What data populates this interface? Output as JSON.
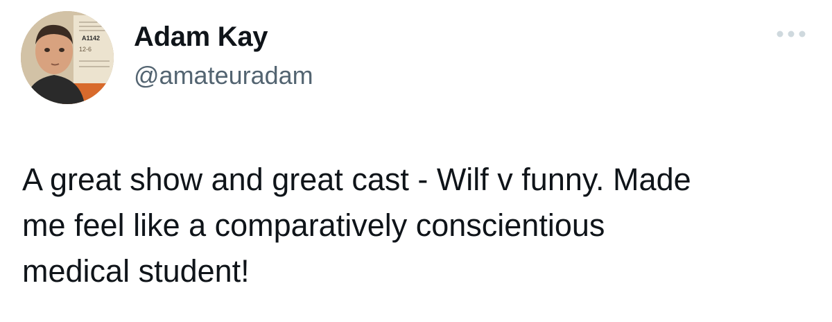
{
  "tweet": {
    "author": {
      "display_name": "Adam Kay",
      "handle": "@amateuradam",
      "avatar_card_text": {
        "id": "A1142",
        "date": "12-6"
      }
    },
    "more_icon": "more-horizontal-icon",
    "text": "A great show and great cast - Wilf v funny. Made\nme feel like a comparatively conscientious\nmedical student!"
  },
  "colors": {
    "text": "#0f1419",
    "secondary_text": "#536471",
    "background": "#ffffff",
    "more_icon": "#cfd9de"
  }
}
